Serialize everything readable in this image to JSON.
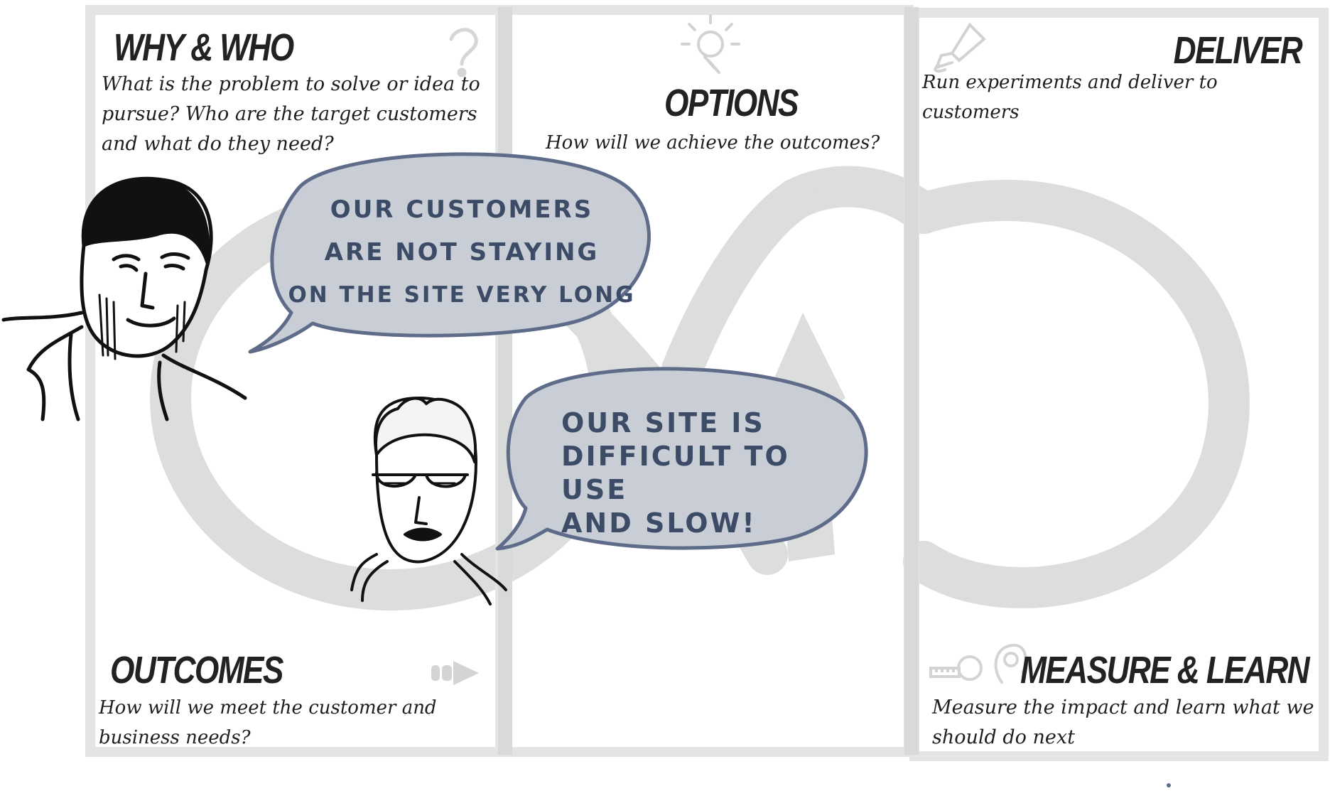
{
  "sections": {
    "why_who": {
      "title": "WHY & WHO",
      "description": "What is the problem to solve or idea to pursue? Who are the target customers and what do they need?"
    },
    "options": {
      "title": "OPTIONS",
      "description": "How will we achieve the outcomes?"
    },
    "deliver": {
      "title": "DELIVER",
      "description": "Run experiments and deliver to customers"
    },
    "outcomes": {
      "title": "OUTCOMES",
      "description": "How will we meet the customer and business needs?"
    },
    "measure_learn": {
      "title": "MEASURE & LEARN",
      "description": "Measure the impact and learn what we should do next"
    }
  },
  "bubbles": {
    "first": {
      "line1": "Our customers",
      "line2": "are not staying",
      "line3": "on the site very long"
    },
    "second": {
      "line1": "Our site is",
      "line2": "difficult to use",
      "line3": "and slow!"
    }
  },
  "colors": {
    "frame": "#e3e4e4",
    "bubble_fill": "#c8cdd6",
    "bubble_stroke": "#5e6c8a",
    "loop": "#dcdddd"
  },
  "icons": [
    "question-icon",
    "lightbulb-icon",
    "rocket-icon",
    "arrow-right-icon",
    "tape-measure-icon",
    "brain-head-icon"
  ]
}
